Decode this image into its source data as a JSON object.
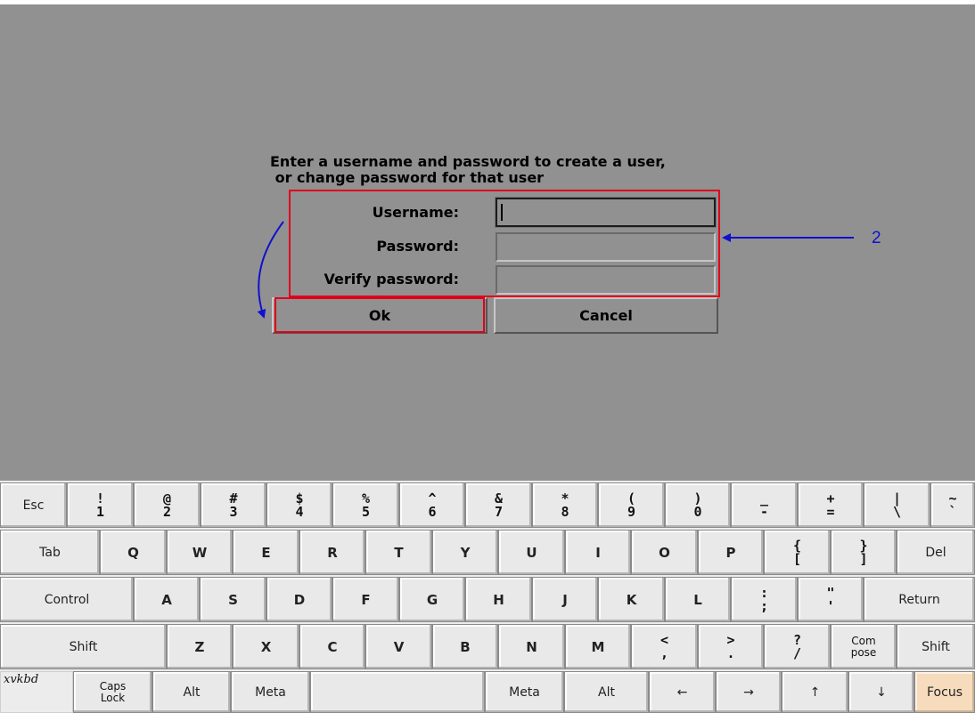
{
  "dialog": {
    "prompt_line1": "Enter a username and password to create a user,",
    "prompt_line2": " or change password for that user",
    "username_label": "Username:",
    "password_label": "Password:",
    "verify_label": "Verify password:",
    "username_value": "",
    "password_value": "",
    "verify_value": "",
    "ok_label": "Ok",
    "cancel_label": "Cancel"
  },
  "annotation": {
    "callout_number": "2",
    "highlight_color": "#e0001b",
    "arrow_color": "#1010d0"
  },
  "keyboard": {
    "logo": "xvkbd",
    "row1": [
      {
        "id": "esc",
        "label": "Esc"
      },
      {
        "id": "1",
        "top": "!",
        "bottom": "1"
      },
      {
        "id": "2",
        "top": "@",
        "bottom": "2"
      },
      {
        "id": "3",
        "top": "#",
        "bottom": "3"
      },
      {
        "id": "4",
        "top": "$",
        "bottom": "4"
      },
      {
        "id": "5",
        "top": "%",
        "bottom": "5"
      },
      {
        "id": "6",
        "top": "^",
        "bottom": "6"
      },
      {
        "id": "7",
        "top": "&",
        "bottom": "7"
      },
      {
        "id": "8",
        "top": "*",
        "bottom": "8"
      },
      {
        "id": "9",
        "top": "(",
        "bottom": "9"
      },
      {
        "id": "0",
        "top": ")",
        "bottom": "0"
      },
      {
        "id": "minus",
        "top": "_",
        "bottom": "-"
      },
      {
        "id": "equal",
        "top": "+",
        "bottom": "="
      },
      {
        "id": "backslash",
        "top": "|",
        "bottom": "\\"
      },
      {
        "id": "grave",
        "top": "~",
        "bottom": "`"
      }
    ],
    "row2": [
      "Tab",
      "Q",
      "W",
      "E",
      "R",
      "T",
      "Y",
      "U",
      "I",
      "O",
      "P",
      "{[",
      "}]",
      "Del"
    ],
    "row3": [
      "Control",
      "A",
      "S",
      "D",
      "F",
      "G",
      "H",
      "J",
      "K",
      "L",
      ";:",
      "\"'",
      "Return"
    ],
    "row4": [
      "Shift",
      "Z",
      "X",
      "C",
      "V",
      "B",
      "N",
      "M",
      "<,",
      ">.",
      "?/",
      "Com pose",
      "Shift"
    ],
    "row5": [
      "Caps Lock",
      "Alt",
      "Meta",
      "",
      "Meta",
      "Alt",
      "←",
      "→",
      "↑",
      "↓",
      "Focus"
    ],
    "focus_color": "#f6dcbd"
  }
}
